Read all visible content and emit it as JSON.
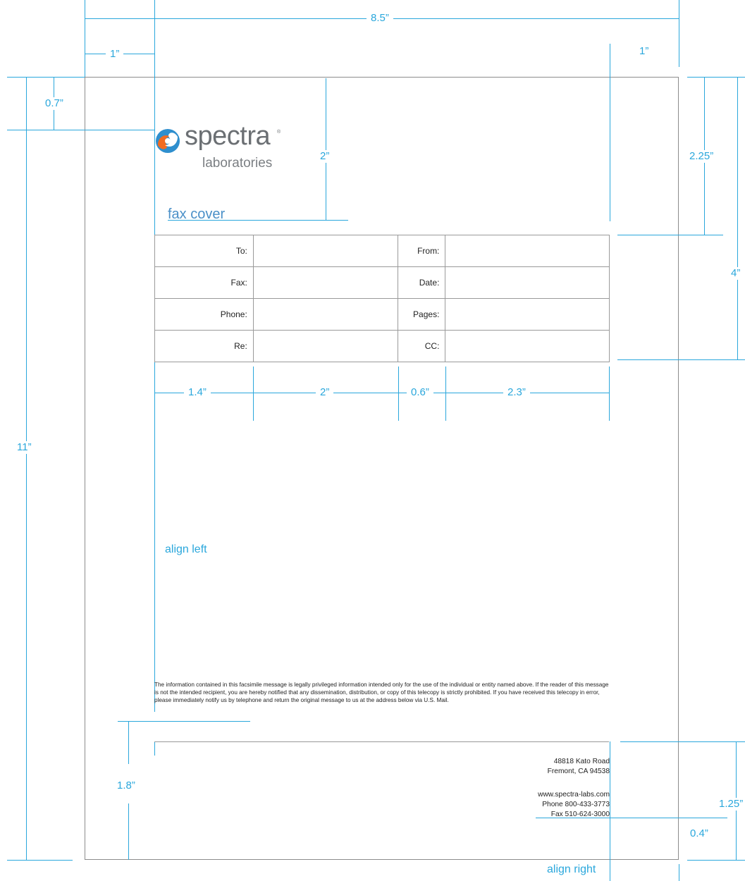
{
  "logo": {
    "wordmark": "spectra",
    "registered_mark": "®",
    "subtitle": "laboratories"
  },
  "title": "fax cover",
  "form": {
    "rows": [
      {
        "left_label": "To:",
        "left_value": "",
        "right_label": "From:",
        "right_value": ""
      },
      {
        "left_label": "Fax:",
        "left_value": "",
        "right_label": "Date:",
        "right_value": ""
      },
      {
        "left_label": "Phone:",
        "left_value": "",
        "right_label": "Pages:",
        "right_value": ""
      },
      {
        "left_label": "Re:",
        "left_value": "",
        "right_label": "CC:",
        "right_value": ""
      }
    ]
  },
  "disclaimer": "The information contained in this facsimile message is legally privileged information intended only for the use of the individual or entity named above. If the reader of this message is not the intended recipient, you are hereby notified that any dissemination, distribution, or copy of this telecopy is strictly prohibited. If you have received this telecopy in error, please immediately notify us by telephone and return the original message to us at the address below via U.S. Mail.",
  "address": {
    "street": "48818 Kato Road",
    "city": "Fremont, CA 94538",
    "web": "www.spectra-labs.com",
    "phone": "Phone  800-433-3773",
    "fax": "Fax  510-624-3000"
  },
  "dimensions": {
    "page_width": "8.5”",
    "left_margin": "1”",
    "right_margin": "1”",
    "top_logo_offset": "0.7”",
    "header_height": "2”",
    "right_header": "2.25”",
    "right_table": "4”",
    "page_height": "11”",
    "col1": "1.4”",
    "col2": "2”",
    "col3": "0.6”",
    "col4": "2.3”",
    "bottom_left": "1.8”",
    "bottom_right": "1.25”",
    "bottom_inner": "0.4”"
  },
  "notes": {
    "align_left": "align left",
    "align_right": "align right"
  },
  "colors": {
    "guide": "#2aa7dc",
    "logo_orange": "#f26b21",
    "logo_blue": "#2f8fce",
    "title": "#4a90c8"
  }
}
